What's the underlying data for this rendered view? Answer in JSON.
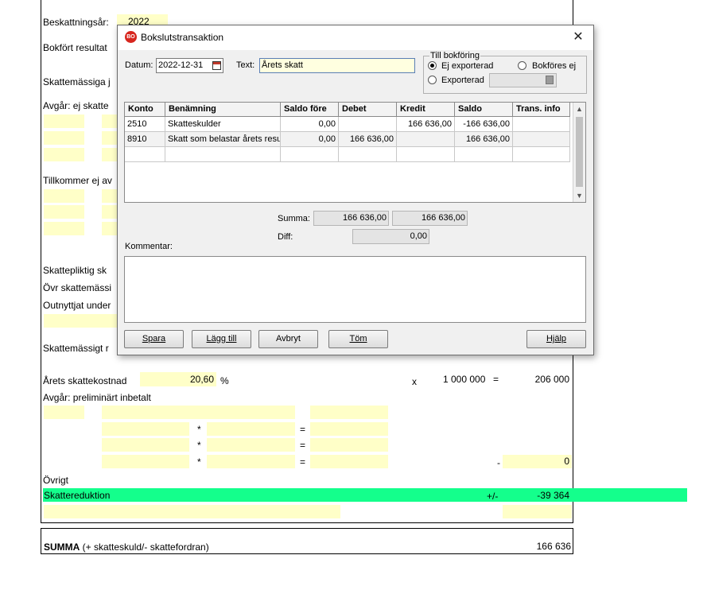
{
  "form": {
    "beskattningsar_label": "Beskattningsår:",
    "beskattningsar_value": "2022",
    "bokfort_resultat": "Bokfört resultat",
    "skattemassiga": "Skattemässiga j",
    "avgar_ej": "Avgår: ej skatte",
    "tillkommer": "Tillkommer ej av",
    "skattepliktig": "Skattepliktig sk",
    "ovr_skattemassig": "Övr skattemässi",
    "outnyttjat": "Outnyttjat under",
    "skattemassigt_r": "Skattemässigt r",
    "arets_skattekostnad": "Årets skattekostnad",
    "skattesats": "20,60",
    "percent": "%",
    "x_symbol": "x",
    "multiplier": "1 000 000",
    "equals": "=",
    "skattekostnad_result": "206 000",
    "avgar_prelim": "Avgår: preliminärt inbetalt",
    "star": "*",
    "minus": "-",
    "prelim_total": "0",
    "ovrigt": "Övrigt",
    "skattereduktion": "Skattereduktion",
    "plusminus": "+/-",
    "skattereduktion_value": "-39 364",
    "summa_bold": "SUMMA",
    "summa_rest": " (+ skatteskuld/- skattefordran)",
    "summa_value": "166 636"
  },
  "dialog": {
    "title": "Bokslutstransaktion",
    "app_icon_text": "BO",
    "close_glyph": "✕",
    "datum_label": "Datum:",
    "datum_value": "2022-12-31",
    "text_label": "Text:",
    "text_value": "Årets skatt",
    "till_bokforing_label": "Till bokföring",
    "radio_ej_exporterad": "Ej exporterad",
    "radio_bokfores_ej": "Bokföres ej",
    "radio_exporterad": "Exporterad",
    "exporterad_value": "",
    "columns": [
      "Konto",
      "Benämning",
      "Saldo före",
      "Debet",
      "Kredit",
      "Saldo",
      "Trans. info"
    ],
    "rows": [
      [
        "2510",
        "Skatteskulder",
        "0,00",
        "",
        "166 636,00",
        "-166 636,00",
        ""
      ],
      [
        "8910",
        "Skatt som belastar årets resultat",
        "0,00",
        "166 636,00",
        "",
        "166 636,00",
        ""
      ],
      [
        "",
        "",
        "",
        "",
        "",
        "",
        ""
      ]
    ],
    "summa_label": "Summa:",
    "summa_debet": "166 636,00",
    "summa_kredit": "166 636,00",
    "diff_label": "Diff:",
    "diff_value": "0,00",
    "kommentar_label": "Kommentar:",
    "kommentar_value": "",
    "buttons": {
      "spara": "Spara",
      "lagg_till": "Lägg till",
      "avbryt": "Avbryt",
      "tom": "Töm",
      "hjalp": "Hjälp"
    }
  },
  "colors": {
    "yellow_field": "#ffffc8",
    "green_row": "#14ff8c",
    "dialog_bg": "#f0f0f0"
  }
}
